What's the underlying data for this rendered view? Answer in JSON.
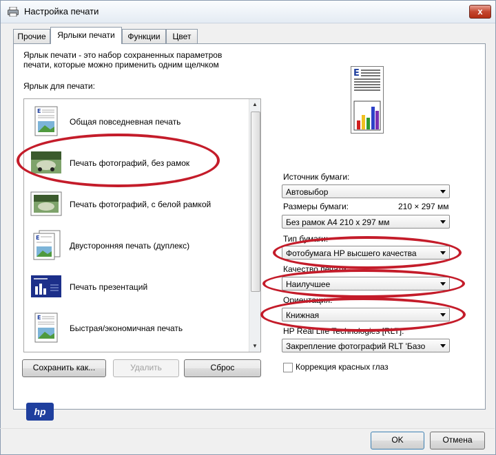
{
  "window": {
    "title": "Настройка печати",
    "close_label": "x"
  },
  "tabs": [
    {
      "label": "Прочие",
      "active": false
    },
    {
      "label": "Ярлыки печати",
      "active": true
    },
    {
      "label": "Функции",
      "active": false
    },
    {
      "label": "Цвет",
      "active": false
    }
  ],
  "main": {
    "description_line1": "Ярлык печати - это набор сохраненных параметров",
    "description_line2": "печати, которые можно применить одним щелчком",
    "shortcuts_label": "Ярлык для печати:",
    "shortcuts": [
      {
        "label": "Общая повседневная печать",
        "icon": "document-icon"
      },
      {
        "label": "Печать фотографий, без рамок",
        "icon": "photo-borderless-icon"
      },
      {
        "label": "Печать фотографий, с белой рамкой",
        "icon": "photo-white-border-icon"
      },
      {
        "label": "Двусторонняя печать (дуплекс)",
        "icon": "duplex-document-icon"
      },
      {
        "label": "Печать презентаций",
        "icon": "presentation-icon"
      },
      {
        "label": "Быстрая/экономичная печать",
        "icon": "document-icon"
      }
    ],
    "buttons": {
      "save_as": "Сохранить как...",
      "delete": "Удалить",
      "reset": "Сброс"
    }
  },
  "settings": {
    "paper_source_label": "Источник бумаги:",
    "paper_source_value": "Автовыбор",
    "paper_size_label": "Размеры бумаги:",
    "paper_size_dims": "210 × 297 мм",
    "paper_size_value": "Без рамок А4 210 x 297 мм",
    "paper_type_label": "Тип бумаги:",
    "paper_type_value": "Фотобумага HP высшего качества",
    "print_quality_label": "Качество печати:",
    "print_quality_value": "Наилучшее",
    "orientation_label": "Ориентация:",
    "orientation_value": "Книжная",
    "hp_real_life_label": "HP Real Life Technologies [RLT]:",
    "hp_real_life_value": "Закрепление фотографий RLT 'Базо",
    "red_eye_label": "Коррекция красных глаз",
    "red_eye_checked": false
  },
  "footer": {
    "ok_label": "OK",
    "cancel_label": "Отмена",
    "logo_text": "hp"
  },
  "colors": {
    "annotation_red": "#c41c2a"
  }
}
